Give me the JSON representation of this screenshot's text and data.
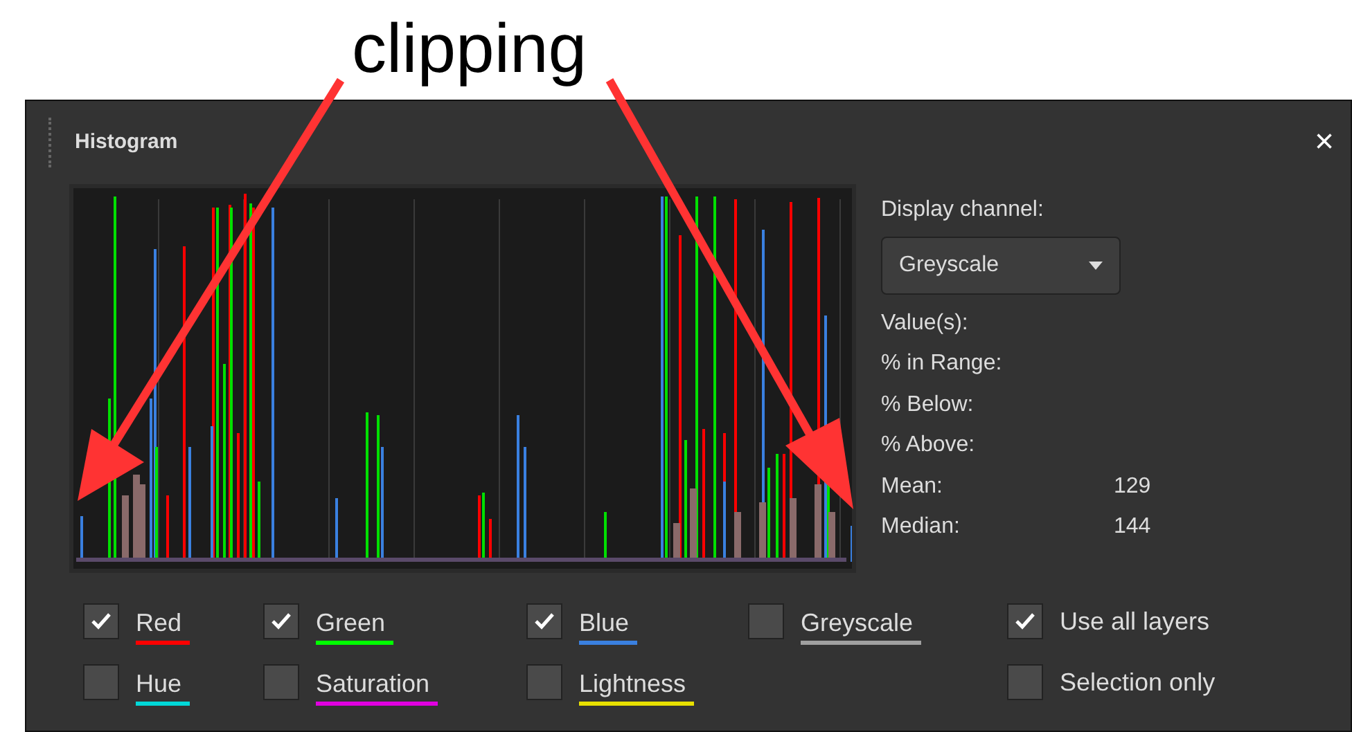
{
  "annotation": {
    "label": "clipping"
  },
  "panel": {
    "title": "Histogram",
    "close": "×"
  },
  "display": {
    "label": "Display channel:",
    "dropdown": "Greyscale",
    "stats": [
      {
        "label": "Value(s):"
      },
      {
        "label": "% in Range:"
      },
      {
        "label": "% Below:"
      },
      {
        "label": "% Above:"
      },
      {
        "label": "Mean:",
        "value": "129"
      },
      {
        "label": "Median:",
        "value": "144"
      }
    ]
  },
  "channels": [
    {
      "label": "Red",
      "checked": true,
      "color": "#ff0000"
    },
    {
      "label": "Green",
      "checked": true,
      "color": "#00ff00"
    },
    {
      "label": "Blue",
      "checked": true,
      "color": "#3a80e0"
    },
    {
      "label": "Greyscale",
      "checked": false,
      "color": "#a0a0a0"
    },
    {
      "label": "Hue",
      "checked": false,
      "color": "#00d8d8"
    },
    {
      "label": "Saturation",
      "checked": false,
      "color": "#e000e0"
    },
    {
      "label": "Lightness",
      "checked": false,
      "color": "#e8e000"
    }
  ],
  "options": [
    {
      "label": "Use all layers",
      "checked": true
    },
    {
      "label": "Selection only",
      "checked": false
    }
  ]
}
